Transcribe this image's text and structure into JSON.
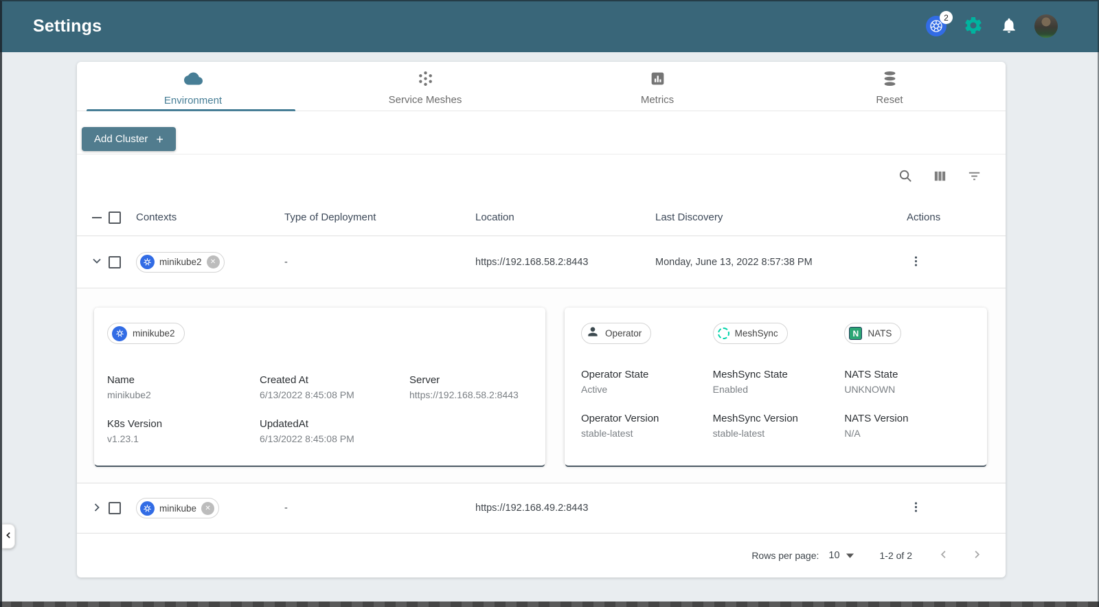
{
  "header": {
    "title": "Settings",
    "k8s_context_count": "2"
  },
  "tabs": {
    "environment": "Environment",
    "service_meshes": "Service Meshes",
    "metrics": "Metrics",
    "reset": "Reset"
  },
  "actions_bar": {
    "add_cluster": "Add Cluster",
    "plus": "+"
  },
  "table": {
    "columns": {
      "contexts": "Contexts",
      "deployment": "Type of Deployment",
      "location": "Location",
      "last_discovery": "Last Discovery",
      "actions": "Actions"
    },
    "rows": [
      {
        "context": "minikube2",
        "deployment": "-",
        "location": "https://192.168.58.2:8443",
        "last_discovery": "Monday, June 13, 2022 8:57:38 PM"
      },
      {
        "context": "minikube",
        "deployment": "-",
        "location": "https://192.168.49.2:8443",
        "last_discovery": ""
      }
    ]
  },
  "details": {
    "cluster": {
      "chip": "minikube2",
      "name_label": "Name",
      "name": "minikube2",
      "created_label": "Created At",
      "created": "6/13/2022 8:45:08 PM",
      "server_label": "Server",
      "server": "https://192.168.58.2:8443",
      "k8s_version_label": "K8s Version",
      "k8s_version": "v1.23.1",
      "updated_label": "UpdatedAt",
      "updated": "6/13/2022 8:45:08 PM"
    },
    "operator": {
      "chip_operator": "Operator",
      "chip_meshsync": "MeshSync",
      "chip_nats": "NATS",
      "operator_state_label": "Operator State",
      "operator_state": "Active",
      "meshsync_state_label": "MeshSync State",
      "meshsync_state": "Enabled",
      "nats_state_label": "NATS State",
      "nats_state": "UNKNOWN",
      "operator_version_label": "Operator Version",
      "operator_version": "stable-latest",
      "meshsync_version_label": "MeshSync Version",
      "meshsync_version": "stable-latest",
      "nats_version_label": "NATS Version",
      "nats_version": "N/A"
    }
  },
  "pagination": {
    "rows_per_page_label": "Rows per page:",
    "rows_per_page": "10",
    "range": "1-2 of 2"
  },
  "icons": {
    "kubernetes": "blue helm wheel",
    "settings_gear": "green gear",
    "notifications": "bell",
    "environment": "cloud",
    "service_meshes": "mesh dots",
    "metrics": "bar chart",
    "reset": "database"
  },
  "colors": {
    "header_bg": "#396679",
    "accent": "#477E96",
    "brand_green": "#00B39F",
    "k8s_blue": "#326CE5",
    "meshsync_green": "#00D3A9",
    "nats_green": "#2ba574"
  }
}
